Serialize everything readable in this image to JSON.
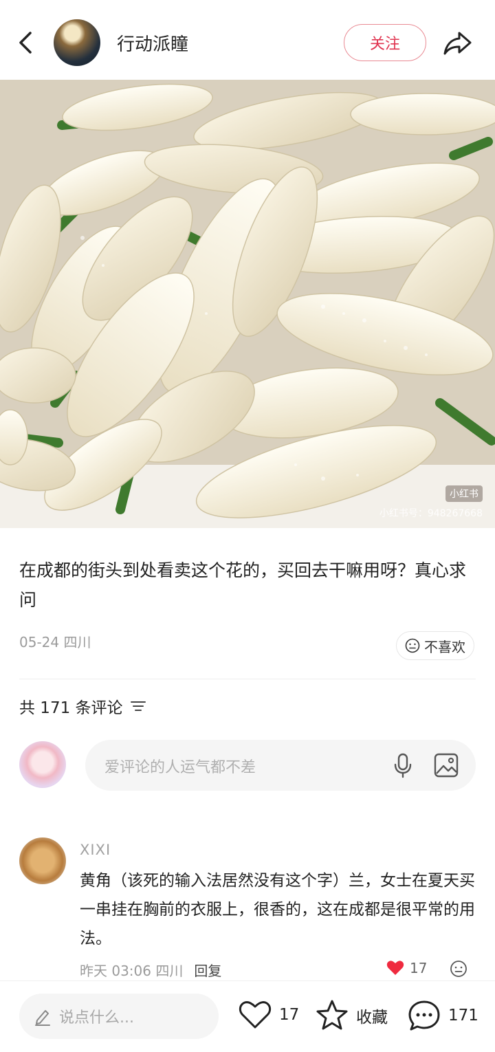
{
  "header": {
    "author_name": "行动派瞳",
    "follow_label": "关注"
  },
  "photo": {
    "watermark_logo": "小红书",
    "watermark_id": "小红书号：948267668"
  },
  "post": {
    "description": "在成都的街头到处看卖这个花的，买回去干嘛用呀？真心求问",
    "date_location": "05-24 四川",
    "dislike_label": "不喜欢"
  },
  "comments_section": {
    "count_text": "共 171 条评论",
    "input_placeholder": "爱评论的人运气都不差"
  },
  "comment": {
    "user": "XIXI",
    "text": "黄角（该死的输入法居然没有这个字）兰，女士在夏天买一串挂在胸前的衣服上，很香的，这在成都是很平常的用法。",
    "time": "昨天  03:06 四川",
    "reply_label": "回复",
    "like_count": "17"
  },
  "bottom_bar": {
    "say_placeholder": "说点什么...",
    "like_count": "17",
    "collect_label": "收藏",
    "comment_count": "171"
  },
  "colors": {
    "accent": "#e0334f",
    "like_red": "#ef2a3f",
    "muted": "#9a9a9a"
  }
}
